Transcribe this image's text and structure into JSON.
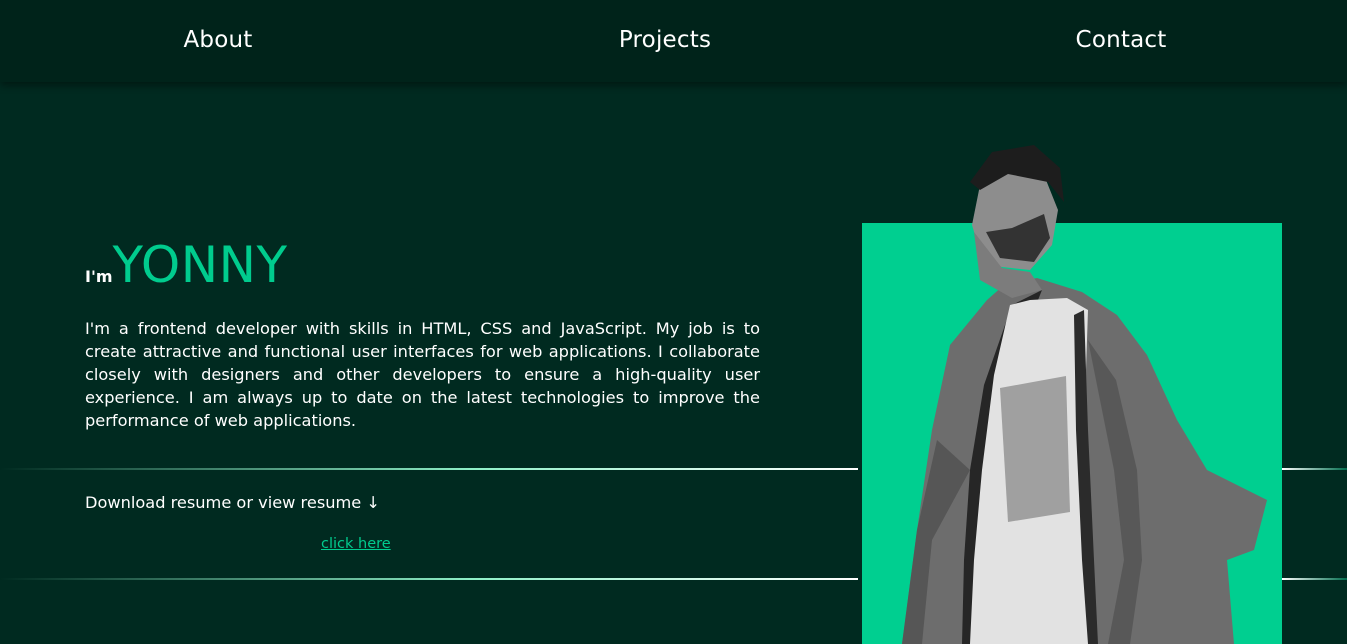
{
  "nav": {
    "items": [
      {
        "label": "About"
      },
      {
        "label": "Projects"
      },
      {
        "label": "Contact"
      }
    ]
  },
  "hero": {
    "prefix": "I'm",
    "name": "YONNY",
    "bio": "I'm a frontend developer with skills in HTML, CSS and JavaScript. My job is to create attractive and functional user interfaces for web applications. I collaborate closely with designers and other developers to ensure a high-quality user experience. I am always up to date on the latest technologies to improve the performance of web applications."
  },
  "resume": {
    "text": "Download resume or view resume ↓",
    "link_label": "click here"
  },
  "colors": {
    "background": "#002a20",
    "nav_background": "#00231a",
    "accent": "#00cc8e"
  },
  "icons": {
    "resume_arrow": "arrow-down-icon"
  }
}
